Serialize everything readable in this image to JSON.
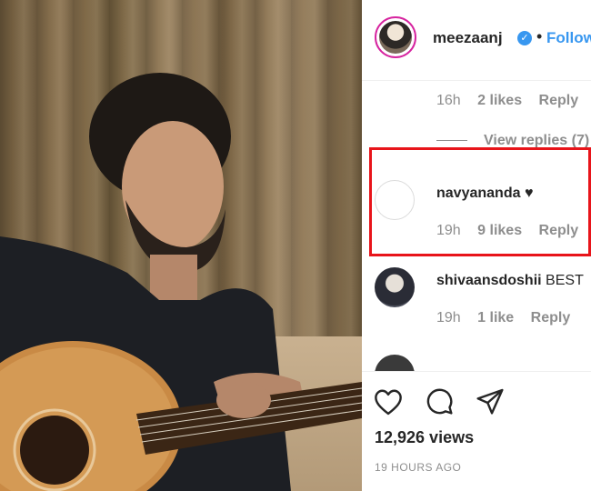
{
  "post": {
    "username": "meezaanj",
    "follow_label": "Follow",
    "separator": "•"
  },
  "comments": [
    {
      "time": "16h",
      "likes": "2 likes",
      "reply": "Reply",
      "view_replies": "View replies (7)"
    },
    {
      "username": "navyananda",
      "text": "♥",
      "time": "19h",
      "likes": "9 likes",
      "reply": "Reply"
    },
    {
      "username": "shivaansdoshii",
      "text": "BEST",
      "time": "19h",
      "likes": "1 like",
      "reply": "Reply"
    }
  ],
  "footer": {
    "views": "12,926 views",
    "time_ago": "19 HOURS AGO"
  },
  "icons": [
    "heart-icon",
    "comment-icon",
    "share-icon",
    "verified-badge-icon"
  ],
  "colors": {
    "follow": "#3897f0",
    "highlight": "#e8141a",
    "muted": "#8e8e8e"
  }
}
